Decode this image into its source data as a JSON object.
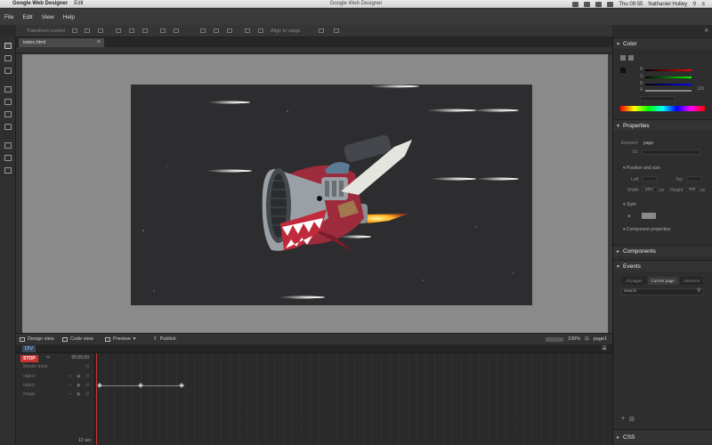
{
  "macbar": {
    "app_name": "Google Web Designer",
    "menu_edit": "Edit",
    "window_title": "Google Web Designer",
    "clock": "Thu 09:55",
    "user": "Nathaniel Hulley"
  },
  "menubar": {
    "items": [
      "File",
      "Edit",
      "View",
      "Help"
    ]
  },
  "toolbar": {
    "transform_control": "Transform control",
    "align_to_stage": "Align to stage"
  },
  "tabs": {
    "document": "index.html"
  },
  "bottombar": {
    "design_view": "Design view",
    "code_view": "Code view",
    "preview": "Preview",
    "publish": "Publish",
    "zoom": "100",
    "zoom_unit": "%",
    "page": "page1"
  },
  "timeline": {
    "breadcrumb": "DIV",
    "stop": "STOP",
    "time": "00:00.00",
    "rows": [
      "Master track",
      "object",
      "object",
      "image"
    ],
    "zoom_value": "12 sec"
  },
  "panels": {
    "color": "Color",
    "rgb": {
      "r": "R",
      "g": "G",
      "b": "B",
      "a": "A",
      "a_value": "100"
    },
    "properties": "Properties",
    "element_label": "Element",
    "element_value": "page",
    "id_label": "ID",
    "position_size": "Position and size",
    "left_label": "Left",
    "top_label": "Top",
    "width_label": "Width",
    "width_value": "1084",
    "height_label": "Height",
    "height_value": "600",
    "px": "px",
    "style": "Style",
    "component_properties": "Component properties",
    "components": "Components",
    "events": "Events",
    "event_tabs": [
      "All pages",
      "Current page",
      "Selection"
    ],
    "search_placeholder": "Search",
    "css": "CSS"
  },
  "colors": {
    "accent_red": "#c33333",
    "stage_bg": "#2d2d2f",
    "workspace_bg": "#8a8a8a",
    "panel_bg": "#2e2e2e"
  }
}
